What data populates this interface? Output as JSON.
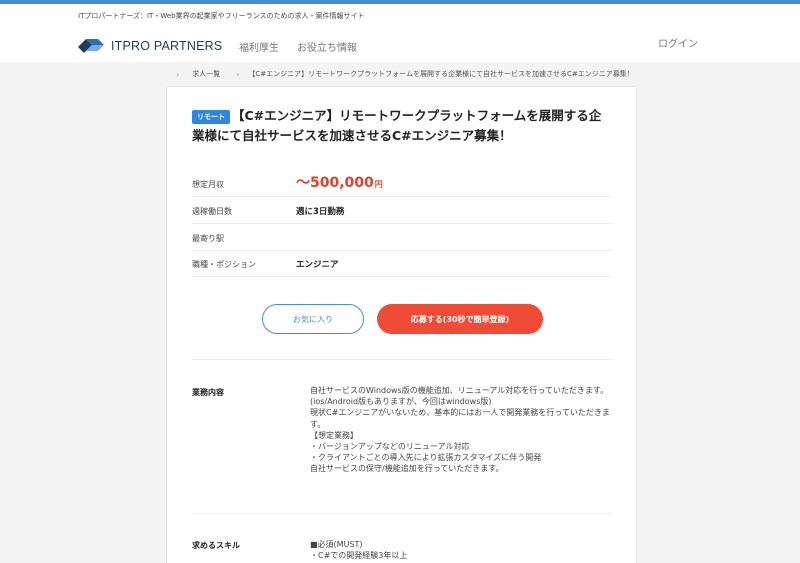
{
  "header": {
    "tagline": "ITプロパートナーズ：IT・Web業界の起業家やフリーランスのための求人・案件情報サイト",
    "logo_text": "ITPRO PARTNERS",
    "nav": [
      "福利厚生",
      "お役立ち情報"
    ],
    "login": "ログイン"
  },
  "breadcrumb": {
    "items": [
      "求人一覧",
      "【C#エンジニア】リモートワークプラットフォームを展開する企業様にて自社サービスを加速させるC#エンジニア募集！"
    ]
  },
  "job": {
    "badge": "リモート",
    "title": "【C#エンジニア】リモートワークプラットフォームを展開する企業様にて自社サービスを加速させるC#エンジニア募集！",
    "salary_label": "想定月収",
    "salary_value": "〜500,000",
    "salary_unit": "円",
    "specs": [
      {
        "label": "週稼働日数",
        "value": "週に3日勤務"
      },
      {
        "label": "最寄り駅",
        "value": ""
      },
      {
        "label": "職種・ポジション",
        "value": "エンジニア"
      }
    ],
    "fav_button": "お気に入り",
    "apply_button": "応募する(30秒で簡単登録)",
    "duties": {
      "label": "業務内容",
      "lines": [
        "自社サービスのWindows版の機能追加、リニューアル対応を行っていただきます。(ios/Android版もありますが、今回はwindows版)",
        "現状C#エンジニアがいないため、基本的にはお一人で開発業務を行っていただきます。",
        "【想定業務】",
        "・バージョンアップなどのリニューアル対応",
        "・クライアントごとの導入先により拡張カスタマイズに伴う開発",
        "自社サービスの保守/機能追加を行っていただきます。"
      ]
    },
    "skills": {
      "label": "求めるスキル",
      "lines": [
        "■必須(MUST)",
        "・C#での開発経験3年以上"
      ]
    }
  },
  "colors": {
    "accent": "#4a90c8",
    "apply": "#f04b37",
    "salary": "#e0402f",
    "badge": "#2e86e0"
  }
}
